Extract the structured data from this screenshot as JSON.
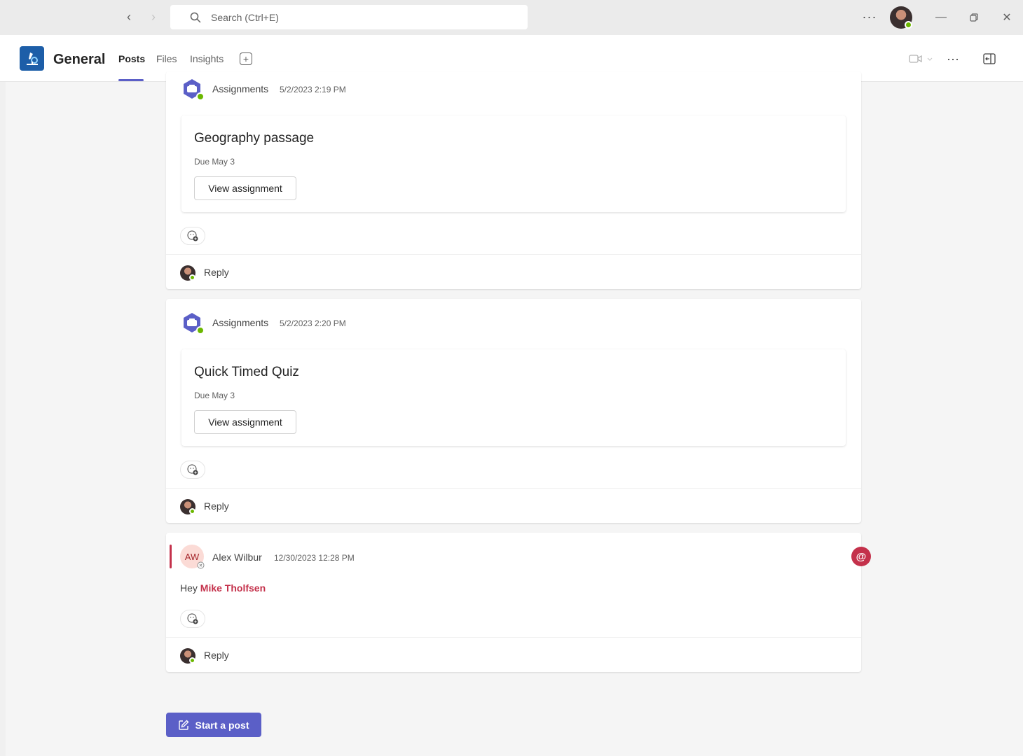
{
  "search": {
    "placeholder": "Search (Ctrl+E)"
  },
  "header": {
    "channel_name": "General",
    "tabs": [
      {
        "label": "Posts",
        "active": true
      },
      {
        "label": "Files",
        "active": false
      },
      {
        "label": "Insights",
        "active": false
      }
    ]
  },
  "posts": [
    {
      "author": "Assignments",
      "timestamp": "5/2/2023 2:19 PM",
      "card": {
        "title": "Geography passage",
        "due": "Due May 3",
        "button": "View assignment"
      },
      "reply_label": "Reply"
    },
    {
      "author": "Assignments",
      "timestamp": "5/2/2023 2:20 PM",
      "card": {
        "title": "Quick Timed Quiz",
        "due": "Due May 3",
        "button": "View assignment"
      },
      "reply_label": "Reply"
    },
    {
      "author": "Alex Wilbur",
      "initials": "AW",
      "timestamp": "12/30/2023 12:28 PM",
      "message_prefix": "Hey",
      "mention": "Mike Tholfsen",
      "reply_label": "Reply"
    }
  ],
  "start_post_label": "Start a post",
  "colors": {
    "accent": "#5b5fc7",
    "mention": "#c4314b",
    "presence": "#6bb700"
  }
}
